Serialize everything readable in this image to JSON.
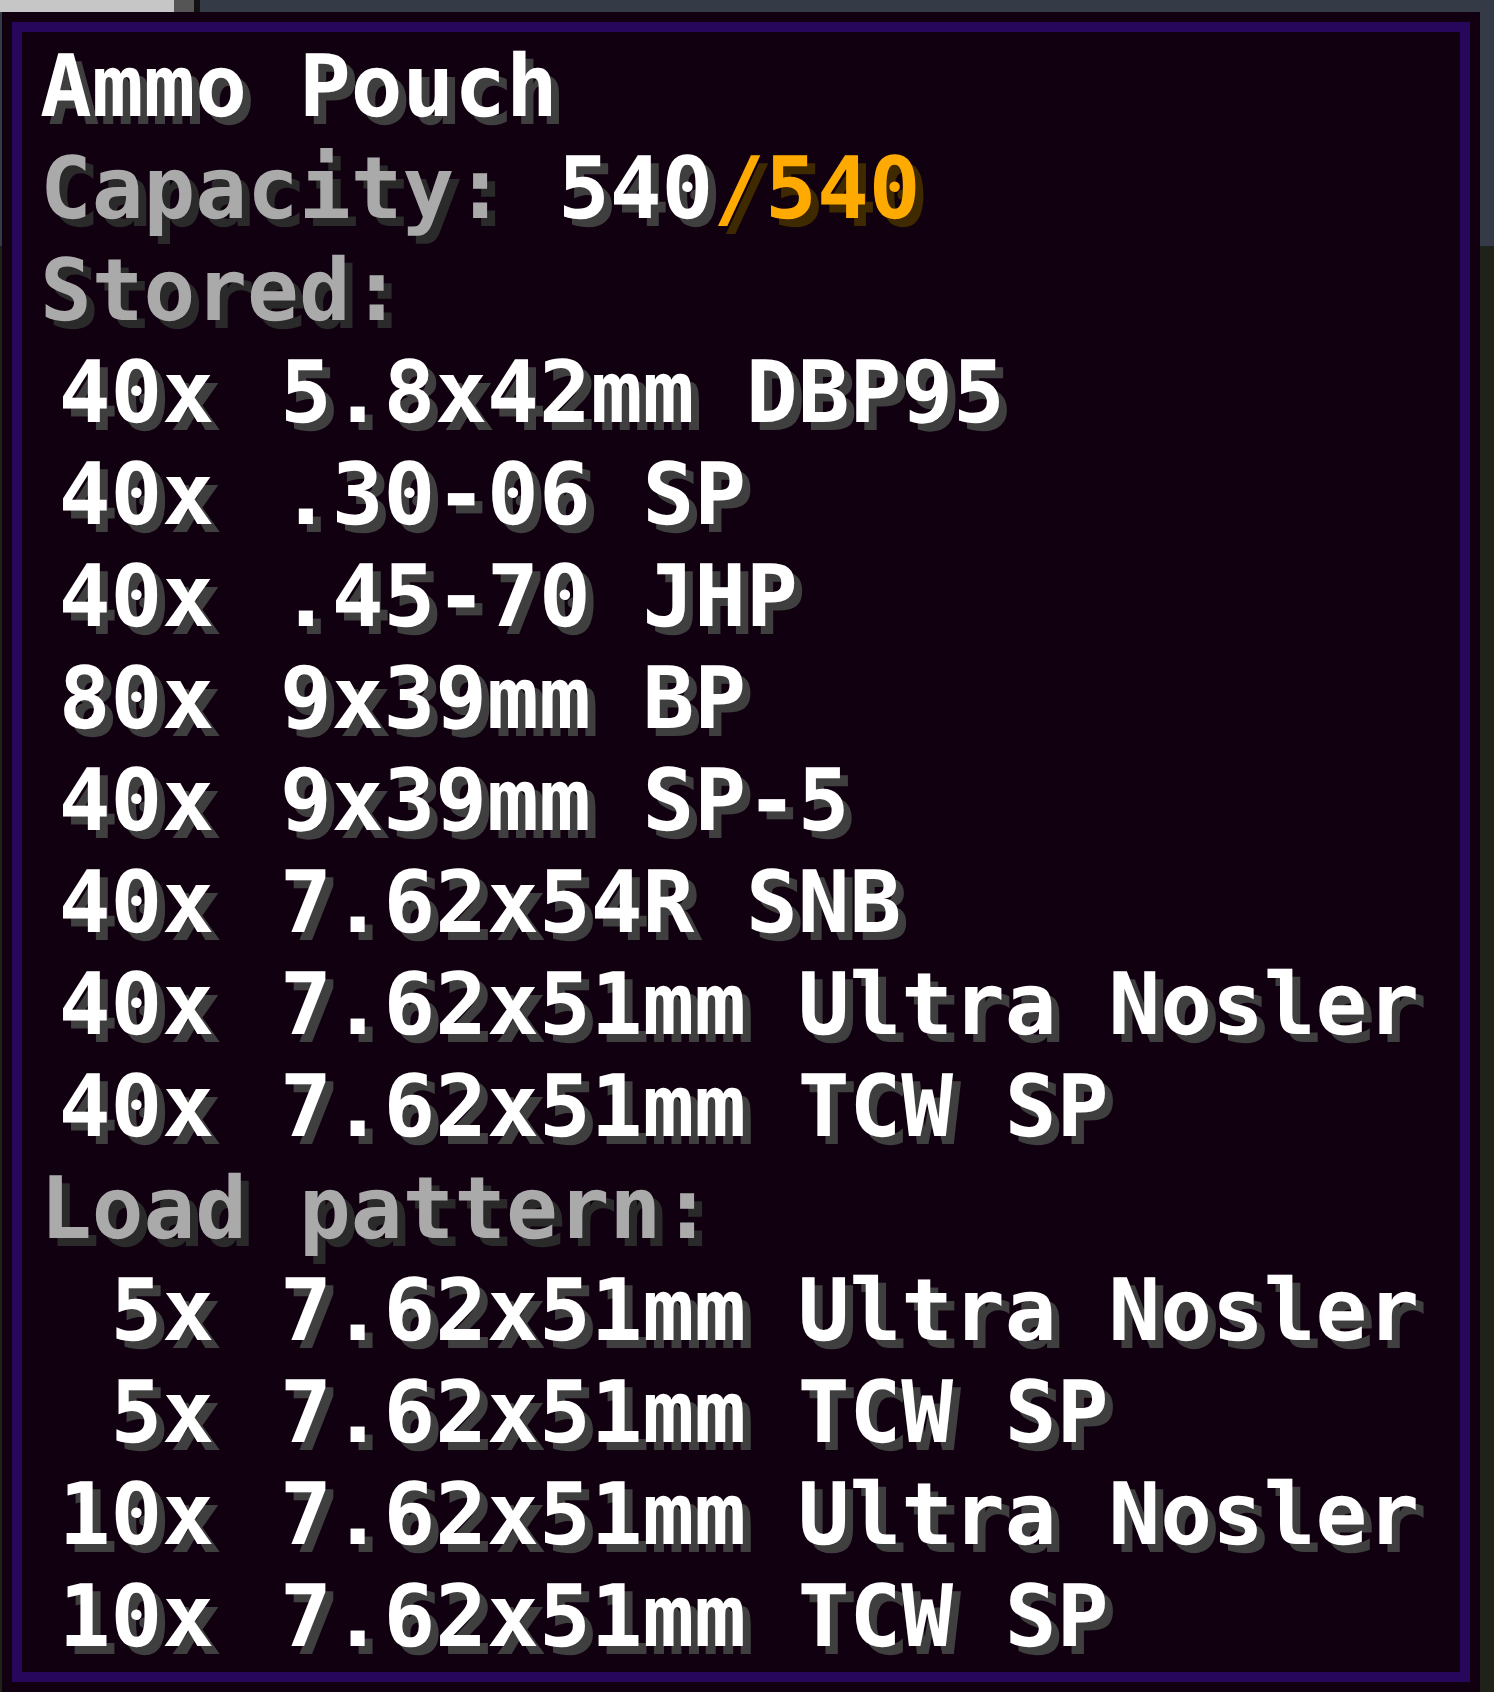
{
  "tooltip": {
    "title": "Ammo Pouch",
    "capacity": {
      "label": "Capacity:",
      "value": "540",
      "limit": "/540"
    },
    "stored": {
      "label": "Stored:",
      "items": [
        {
          "count": "40x",
          "name": "5.8x42mm DBP95"
        },
        {
          "count": "40x",
          "name": ".30-06 SP"
        },
        {
          "count": "40x",
          "name": ".45-70 JHP"
        },
        {
          "count": "80x",
          "name": "9x39mm BP"
        },
        {
          "count": "40x",
          "name": "9x39mm SP-5"
        },
        {
          "count": "40x",
          "name": "7.62x54R SNB"
        },
        {
          "count": "40x",
          "name": "7.62x51mm Ultra Nosler"
        },
        {
          "count": "40x",
          "name": "7.62x51mm TCW SP"
        }
      ]
    },
    "load_pattern": {
      "label": "Load pattern:",
      "items": [
        {
          "count": "5x",
          "name": "7.62x51mm Ultra Nosler"
        },
        {
          "count": "5x",
          "name": "7.62x51mm TCW SP"
        },
        {
          "count": "10x",
          "name": "7.62x51mm Ultra Nosler"
        },
        {
          "count": "10x",
          "name": "7.62x51mm TCW SP"
        }
      ]
    }
  }
}
